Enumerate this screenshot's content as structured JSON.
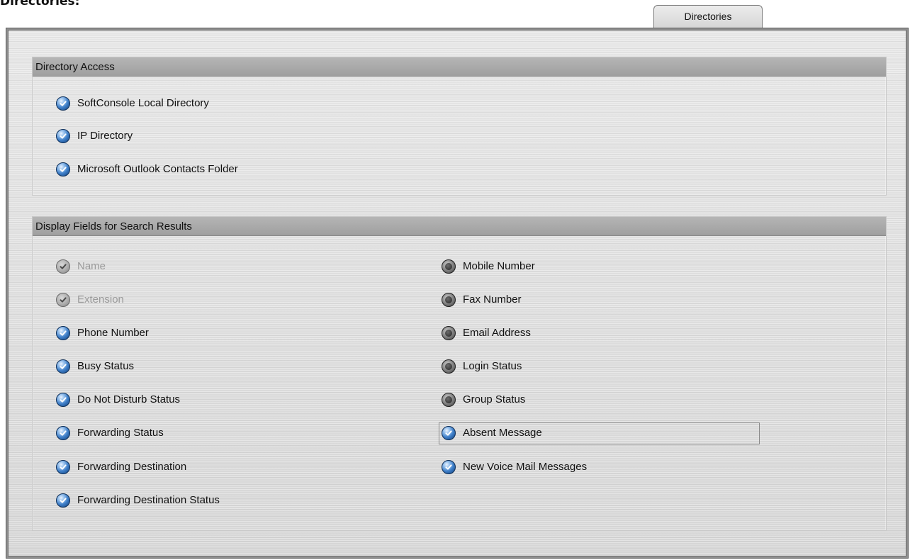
{
  "page": {
    "heading": "Directories:"
  },
  "tab": {
    "label": "Directories"
  },
  "colors": {
    "checked": "#2f6fb8",
    "panel": "#dcdcdc",
    "header": "#a8a8a8"
  },
  "icons": {
    "checked": "blue-check-radio-icon",
    "unchecked": "grey-radio-icon",
    "disabled": "grey-check-radio-icon"
  },
  "directory_access": {
    "title": "Directory Access",
    "items": [
      {
        "label": "SoftConsole Local Directory",
        "state": "checked"
      },
      {
        "label": "IP Directory",
        "state": "checked"
      },
      {
        "label": "Microsoft Outlook Contacts Folder",
        "state": "checked"
      }
    ]
  },
  "display_fields": {
    "title": "Display Fields for Search Results",
    "left": [
      {
        "label": "Name",
        "state": "disabled"
      },
      {
        "label": "Extension",
        "state": "disabled"
      },
      {
        "label": "Phone Number",
        "state": "checked"
      },
      {
        "label": "Busy Status",
        "state": "checked"
      },
      {
        "label": "Do Not Disturb Status",
        "state": "checked"
      },
      {
        "label": "Forwarding Status",
        "state": "checked"
      },
      {
        "label": "Forwarding Destination",
        "state": "checked"
      },
      {
        "label": "Forwarding Destination Status",
        "state": "checked"
      }
    ],
    "right": [
      {
        "label": "Mobile Number",
        "state": "unchecked"
      },
      {
        "label": "Fax Number",
        "state": "unchecked"
      },
      {
        "label": "Email Address",
        "state": "unchecked"
      },
      {
        "label": "Login Status",
        "state": "unchecked"
      },
      {
        "label": "Group Status",
        "state": "unchecked"
      },
      {
        "label": "Absent Message",
        "state": "checked",
        "focused": true
      },
      {
        "label": "New Voice Mail Messages",
        "state": "checked"
      }
    ]
  }
}
